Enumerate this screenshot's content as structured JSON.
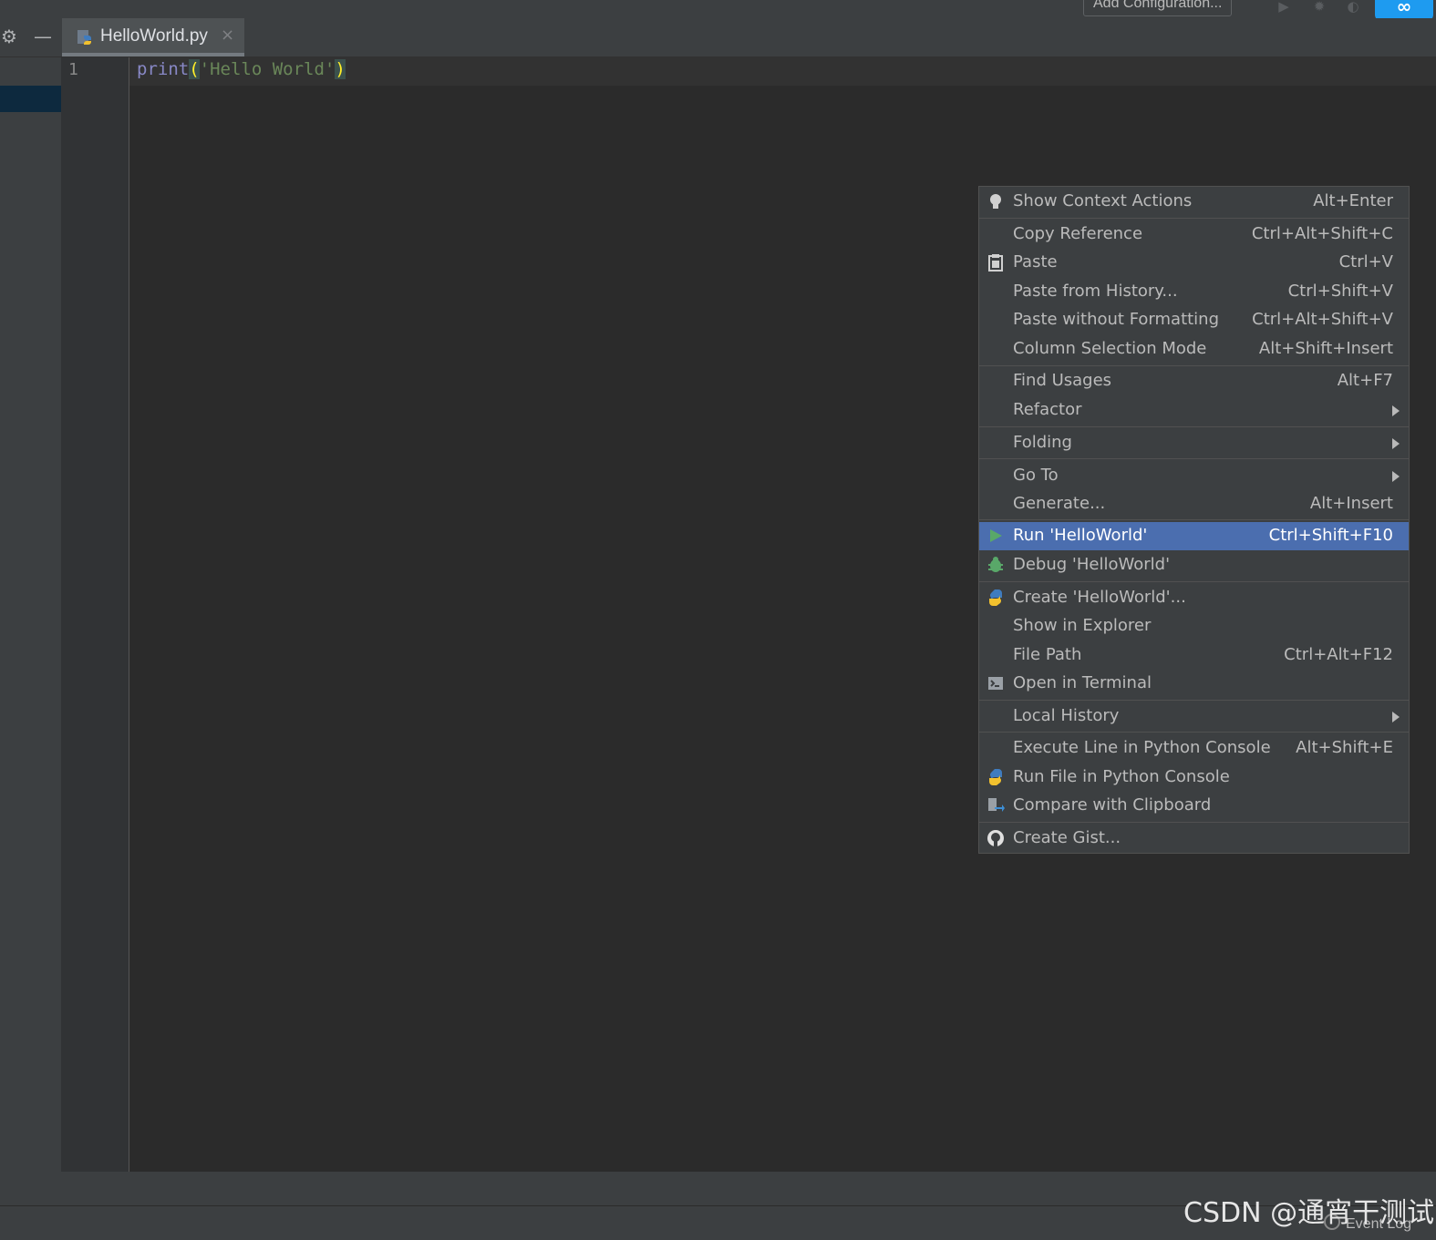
{
  "toolbar": {
    "add_config_label": "Add Configuration..."
  },
  "brand_badge": "∞",
  "editor": {
    "tab_label": "HelloWorld.py",
    "tab_close": "×",
    "line_number": "1",
    "code": {
      "keyword": "print",
      "open_paren": "(",
      "string": "'Hello World'",
      "close_paren": ")"
    }
  },
  "context_menu": {
    "items": [
      {
        "label": "Show Context Actions",
        "shortcut": "Alt+Enter",
        "icon": "lightbulb-icon"
      },
      {
        "label": "Copy Reference",
        "shortcut": "Ctrl+Alt+Shift+C"
      },
      {
        "label": "Paste",
        "shortcut": "Ctrl+V",
        "icon": "clipboard-icon"
      },
      {
        "label": "Paste from History...",
        "shortcut": "Ctrl+Shift+V"
      },
      {
        "label": "Paste without Formatting",
        "shortcut": "Ctrl+Alt+Shift+V"
      },
      {
        "label": "Column Selection Mode",
        "shortcut": "Alt+Shift+Insert"
      },
      {
        "label": "Find Usages",
        "shortcut": "Alt+F7"
      },
      {
        "label": "Refactor",
        "submenu": true
      },
      {
        "label": "Folding",
        "submenu": true
      },
      {
        "label": "Go To",
        "submenu": true
      },
      {
        "label": "Generate...",
        "shortcut": "Alt+Insert"
      },
      {
        "label": "Run 'HelloWorld'",
        "shortcut": "Ctrl+Shift+F10",
        "icon": "run-icon",
        "highlighted": true
      },
      {
        "label": "Debug 'HelloWorld'",
        "icon": "debug-bug-icon"
      },
      {
        "label": "Create 'HelloWorld'...",
        "icon": "python-icon"
      },
      {
        "label": "Show in Explorer"
      },
      {
        "label": "File Path",
        "shortcut": "Ctrl+Alt+F12"
      },
      {
        "label": "Open in Terminal",
        "icon": "terminal-icon"
      },
      {
        "label": "Local History",
        "submenu": true
      },
      {
        "label": "Execute Line in Python Console",
        "shortcut": "Alt+Shift+E"
      },
      {
        "label": "Run File in Python Console",
        "icon": "python-icon"
      },
      {
        "label": "Compare with Clipboard",
        "icon": "compare-icon"
      },
      {
        "label": "Create Gist...",
        "icon": "github-icon"
      }
    ]
  },
  "status": {
    "event_log": "Event Log"
  },
  "watermark": "CSDN @通宵干测试",
  "colors": {
    "highlight": "#4b6eaf",
    "editor_bg": "#2b2b2b",
    "panel_bg": "#3c3f41",
    "run_green": "#59a869"
  }
}
